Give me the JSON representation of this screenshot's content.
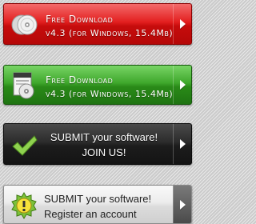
{
  "buttons": {
    "red": {
      "line1": "Free Download",
      "line2": "v4.3 (for Windows, 15.4Mb)",
      "icon": "cd-disc-icon",
      "color": "#e31f1f"
    },
    "green": {
      "line1": "Free Download",
      "line2": "v4.3 (for Windows, 15.4Mb)",
      "icon": "software-box-icon",
      "color": "#3fa82c"
    },
    "dark": {
      "line1": "SUBMIT your software!",
      "line2": "JOIN US!",
      "icon": "checkmark-icon",
      "color": "#2c2c2c"
    },
    "light": {
      "line1": "SUBMIT your software!",
      "line2": "Register an account",
      "icon": "badge-exclamation-icon",
      "color": "#ececec"
    }
  }
}
